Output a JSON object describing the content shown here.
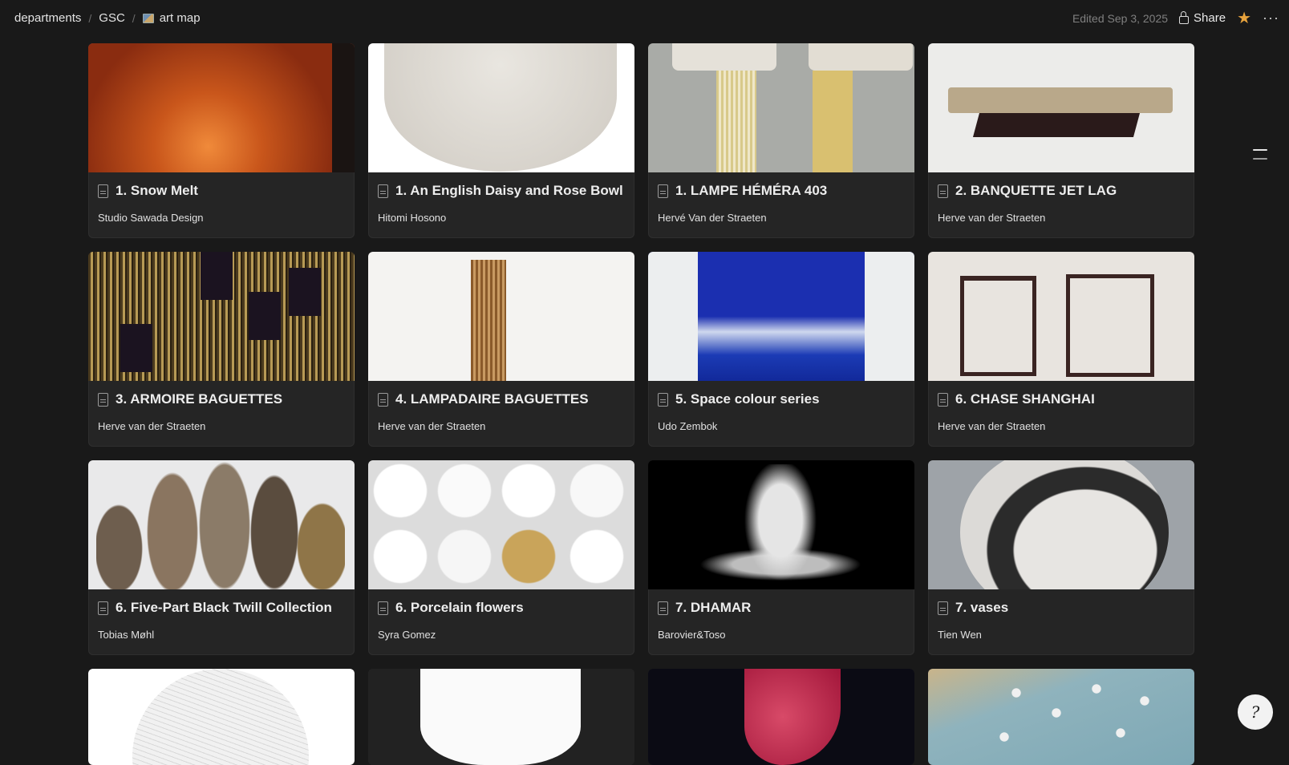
{
  "breadcrumbs": [
    "departments",
    "GSC",
    "art map"
  ],
  "header": {
    "edited": "Edited Sep 3, 2025",
    "share_label": "Share",
    "more_label": "···"
  },
  "help": {
    "glyph": "?"
  },
  "cards": [
    {
      "title": "1. Snow Melt",
      "artist": "Studio Sawada Design"
    },
    {
      "title": "1. An English Daisy and Rose Bowl",
      "artist": "Hitomi Hosono"
    },
    {
      "title": "1. LAMPE HÉMÉRA 403",
      "artist": "Hervé Van der Straeten"
    },
    {
      "title": "2. BANQUETTE JET LAG",
      "artist": "Herve van der Straeten"
    },
    {
      "title": "3. ARMOIRE BAGUETTES",
      "artist": "Herve van der Straeten"
    },
    {
      "title": "4. LAMPADAIRE BAGUETTES",
      "artist": "Herve van der Straeten"
    },
    {
      "title": "5. Space colour series",
      "artist": "Udo Zembok"
    },
    {
      "title": "6. CHASE SHANGHAI",
      "artist": "Herve van der Straeten"
    },
    {
      "title": "6. Five-Part Black Twill Collection",
      "artist": "Tobias Møhl"
    },
    {
      "title": "6. Porcelain flowers",
      "artist": "Syra Gomez"
    },
    {
      "title": "7. DHAMAR",
      "artist": "Barovier&Toso"
    },
    {
      "title": "7. vases",
      "artist": "Tien Wen"
    }
  ],
  "icons": {
    "breadcrumb_page": "image-icon",
    "share": "lock-icon",
    "favorite": "star-icon",
    "card": "page-icon",
    "outline": "outline-icon"
  },
  "colors": {
    "background": "#191919",
    "card": "#252525",
    "star": "#e8a33d"
  }
}
